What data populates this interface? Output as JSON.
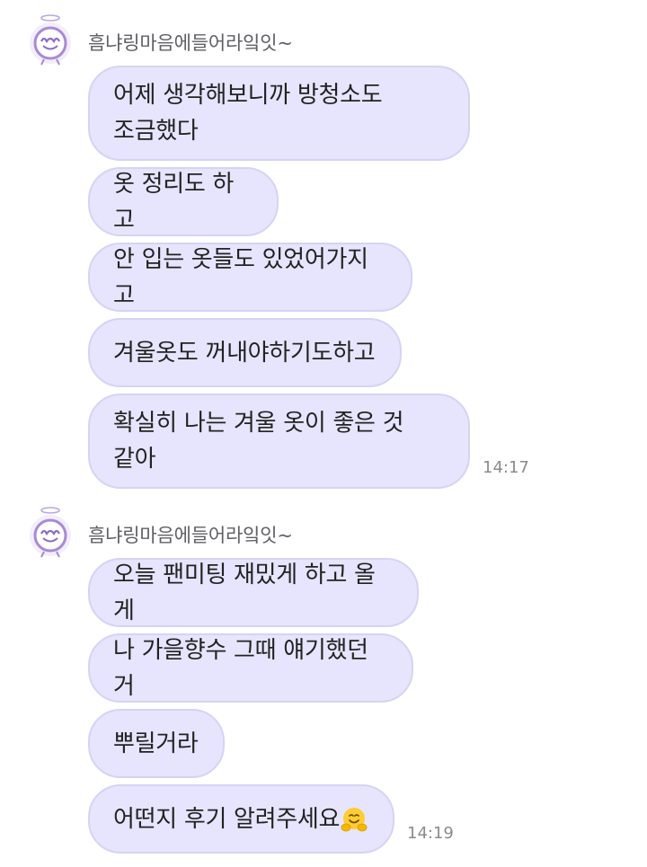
{
  "groups": [
    {
      "sender": "흠냐링마음에들어라잌잇~",
      "messages": [
        {
          "text": "어제 생각해보니까 방청소도\n조금했다"
        },
        {
          "text": "옷 정리도 하고"
        },
        {
          "text": "안 입는 옷들도 있었어가지고"
        },
        {
          "text": "겨울옷도 꺼내야하기도하고"
        },
        {
          "text": "확실히 나는 겨울 옷이 좋은 것\n같아"
        }
      ],
      "time": "14:17"
    },
    {
      "sender": "흠냐링마음에들어라잌잇~",
      "messages": [
        {
          "text": "오늘 팬미팅 재밌게 하고 올게"
        },
        {
          "text": "나 가을향수 그때 얘기했던거"
        },
        {
          "text": "뿌릴거라"
        },
        {
          "text": "어떤지 후기 알려주세요",
          "emoji": "hugging-face-emoji"
        }
      ],
      "time": "14:19"
    }
  ],
  "colors": {
    "bubble_fill": "#e6e5fd",
    "bubble_border": "#d5d3f6",
    "avatar_accent": "#a98ad6"
  }
}
